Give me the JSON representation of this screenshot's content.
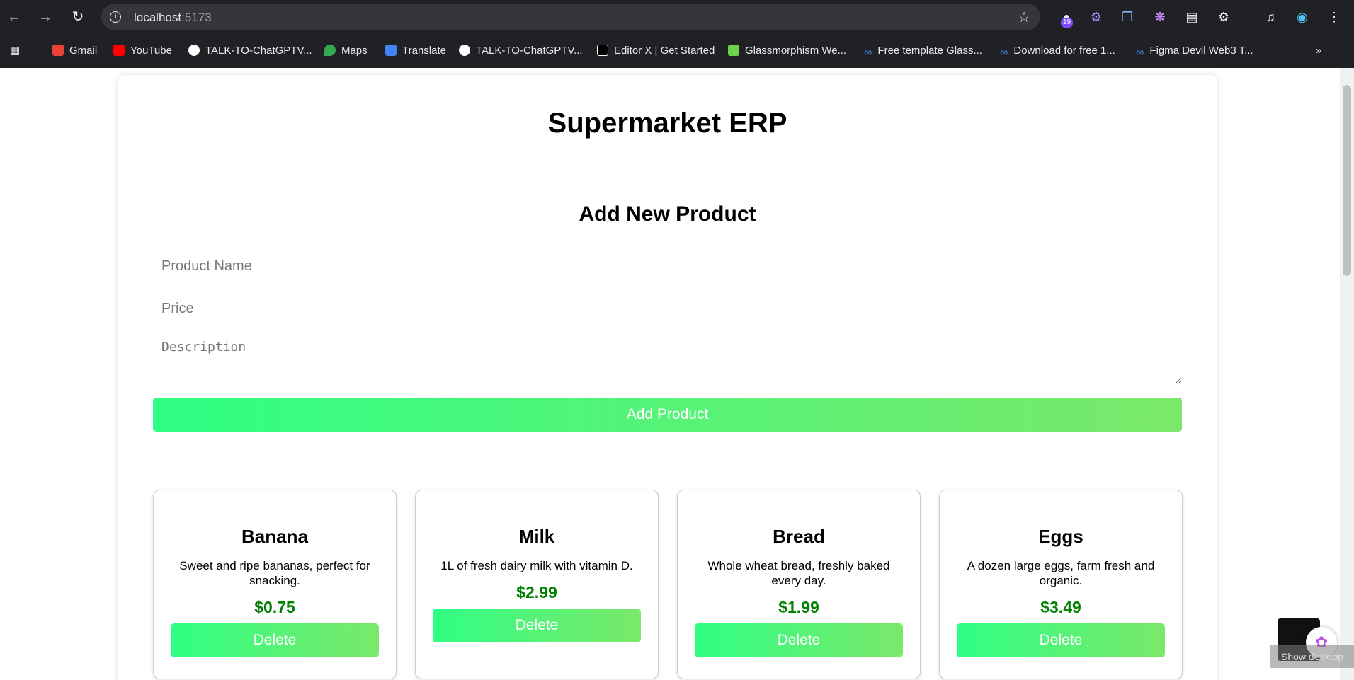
{
  "browser": {
    "url_host": "localhost",
    "url_port": ":5173",
    "extension_badge": "19",
    "bookmarks": [
      {
        "label": "Gmail",
        "icon": "gmail-icon",
        "color": "#ea4335"
      },
      {
        "label": "YouTube",
        "icon": "youtube-icon",
        "color": "#ff0000"
      },
      {
        "label": "TALK-TO-ChatGPTV...",
        "icon": "github-icon",
        "color": "#ffffff"
      },
      {
        "label": "Maps",
        "icon": "maps-icon",
        "color": "#34a853"
      },
      {
        "label": "Translate",
        "icon": "translate-icon",
        "color": "#4285f4"
      },
      {
        "label": "TALK-TO-ChatGPTV...",
        "icon": "github-icon",
        "color": "#ffffff"
      },
      {
        "label": "Editor X | Get Started",
        "icon": "editorx-icon",
        "color": "#000000"
      },
      {
        "label": "Glassmorphism We...",
        "icon": "glassmorphism-icon",
        "color": "#6cd14c"
      },
      {
        "label": "Free template Glass...",
        "icon": "infinity-icon",
        "color": "#4c8bf5"
      },
      {
        "label": "Download for free 1...",
        "icon": "infinity-icon",
        "color": "#4c8bf5"
      },
      {
        "label": "Figma Devil Web3 T...",
        "icon": "infinity-icon",
        "color": "#4c8bf5"
      }
    ]
  },
  "page": {
    "title": "Supermarket ERP",
    "form": {
      "heading": "Add New Product",
      "name_placeholder": "Product Name",
      "price_placeholder": "Price",
      "description_placeholder": "Description",
      "submit_label": "Add Product"
    },
    "products": [
      {
        "name": "Banana",
        "description": "Sweet and ripe bananas, perfect for snacking.",
        "price": "$0.75",
        "delete_label": "Delete"
      },
      {
        "name": "Milk",
        "description": "1L of fresh dairy milk with vitamin D.",
        "price": "$2.99",
        "delete_label": "Delete"
      },
      {
        "name": "Bread",
        "description": "Whole wheat bread, freshly baked every day.",
        "price": "$1.99",
        "delete_label": "Delete"
      },
      {
        "name": "Eggs",
        "description": "A dozen large eggs, farm fresh and organic.",
        "price": "$3.49",
        "delete_label": "Delete"
      }
    ]
  },
  "os": {
    "show_desktop": "Show desktop"
  },
  "colors": {
    "accent_start": "#2fff84",
    "accent_end": "#7be86a",
    "price": "#008000"
  }
}
